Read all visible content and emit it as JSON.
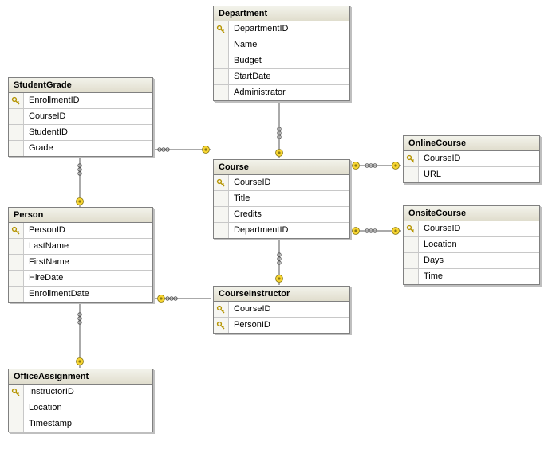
{
  "tables": {
    "studentGrade": {
      "title": "StudentGrade",
      "columns": [
        {
          "name": "EnrollmentID",
          "pk": true
        },
        {
          "name": "CourseID",
          "pk": false
        },
        {
          "name": "StudentID",
          "pk": false
        },
        {
          "name": "Grade",
          "pk": false
        }
      ]
    },
    "department": {
      "title": "Department",
      "columns": [
        {
          "name": "DepartmentID",
          "pk": true
        },
        {
          "name": "Name",
          "pk": false
        },
        {
          "name": "Budget",
          "pk": false
        },
        {
          "name": "StartDate",
          "pk": false
        },
        {
          "name": "Administrator",
          "pk": false
        }
      ]
    },
    "person": {
      "title": "Person",
      "columns": [
        {
          "name": "PersonID",
          "pk": true
        },
        {
          "name": "LastName",
          "pk": false
        },
        {
          "name": "FirstName",
          "pk": false
        },
        {
          "name": "HireDate",
          "pk": false
        },
        {
          "name": "EnrollmentDate",
          "pk": false
        }
      ]
    },
    "course": {
      "title": "Course",
      "columns": [
        {
          "name": "CourseID",
          "pk": true
        },
        {
          "name": "Title",
          "pk": false
        },
        {
          "name": "Credits",
          "pk": false
        },
        {
          "name": "DepartmentID",
          "pk": false
        }
      ]
    },
    "onlineCourse": {
      "title": "OnlineCourse",
      "columns": [
        {
          "name": "CourseID",
          "pk": true
        },
        {
          "name": "URL",
          "pk": false
        }
      ]
    },
    "onsiteCourse": {
      "title": "OnsiteCourse",
      "columns": [
        {
          "name": "CourseID",
          "pk": true
        },
        {
          "name": "Location",
          "pk": false
        },
        {
          "name": "Days",
          "pk": false
        },
        {
          "name": "Time",
          "pk": false
        }
      ]
    },
    "courseInstructor": {
      "title": "CourseInstructor",
      "columns": [
        {
          "name": "CourseID",
          "pk": true
        },
        {
          "name": "PersonID",
          "pk": true
        }
      ]
    },
    "officeAssignment": {
      "title": "OfficeAssignment",
      "columns": [
        {
          "name": "InstructorID",
          "pk": true
        },
        {
          "name": "Location",
          "pk": false
        },
        {
          "name": "Timestamp",
          "pk": false
        }
      ]
    }
  },
  "relationships": [
    {
      "from": "StudentGrade",
      "to": "Course"
    },
    {
      "from": "StudentGrade",
      "to": "Person"
    },
    {
      "from": "Person",
      "to": "OfficeAssignment"
    },
    {
      "from": "Person",
      "to": "CourseInstructor"
    },
    {
      "from": "Course",
      "to": "Department"
    },
    {
      "from": "Course",
      "to": "CourseInstructor"
    },
    {
      "from": "Course",
      "to": "OnlineCourse"
    },
    {
      "from": "Course",
      "to": "OnsiteCourse"
    }
  ]
}
